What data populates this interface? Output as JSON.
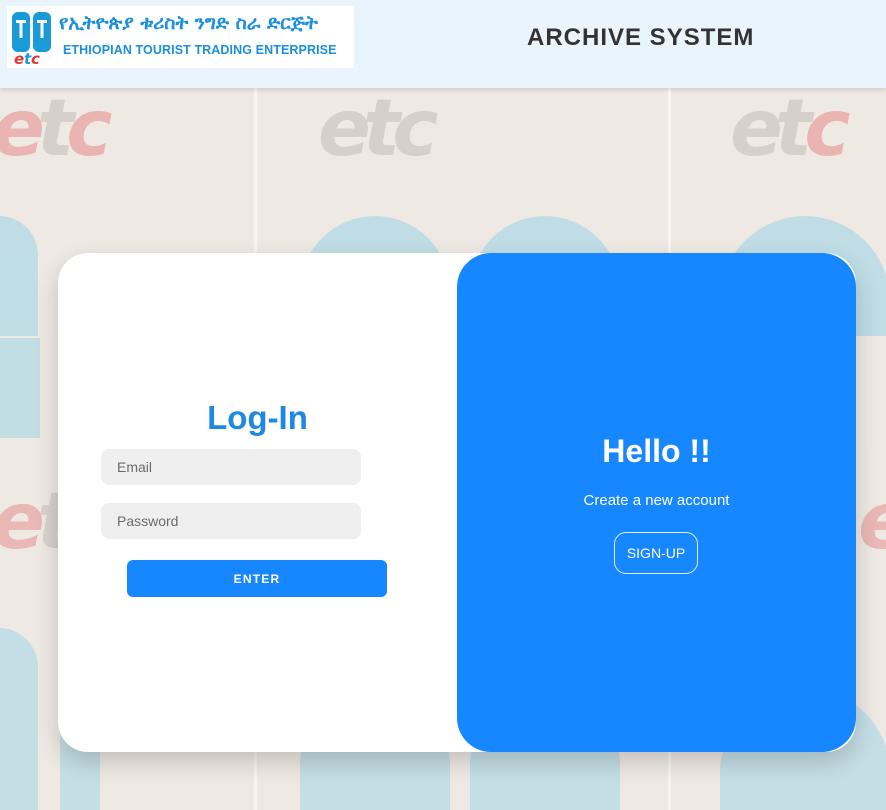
{
  "header": {
    "logo_amharic": "የኢትዮጵያ ቱሪስት ንግድ ስራ ድርጅት",
    "logo_english": "ETHIOPIAN TOURIST TRADING ENTERPRISE",
    "title": "ARCHIVE SYSTEM"
  },
  "login": {
    "title": "Log-In",
    "email_placeholder": "Email",
    "email_value": "",
    "password_placeholder": "Password",
    "password_value": "",
    "enter_label": "ENTER"
  },
  "signup": {
    "heading": "Hello !!",
    "subtext": "Create a new account",
    "button_label": "SIGN-UP"
  },
  "colors": {
    "accent": "#1687ff",
    "title_blue": "#1e88e5",
    "header_bg": "#eaf4fc"
  }
}
